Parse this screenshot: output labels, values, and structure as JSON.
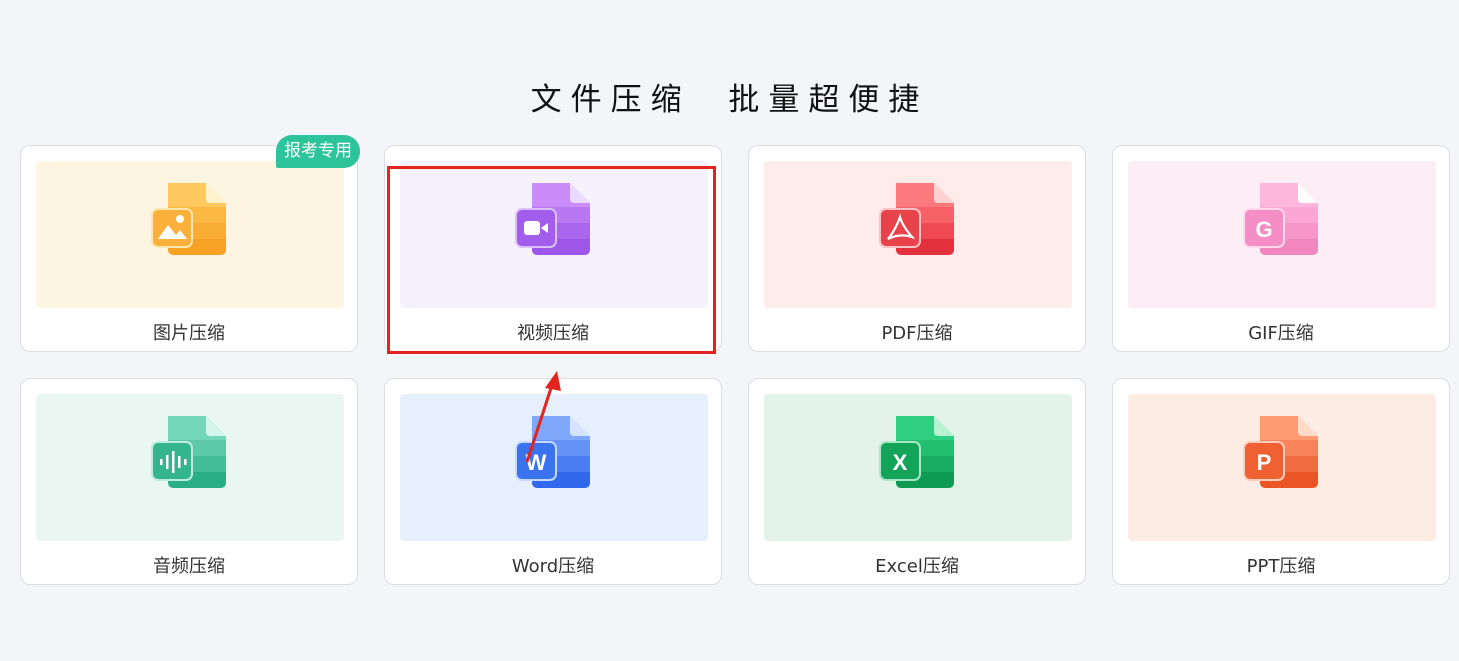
{
  "headline": "文件压缩  批量超便捷",
  "badge": "报考专用",
  "cards": [
    {
      "label": "图片压缩",
      "icon": "image-file-icon",
      "panel_color": "#fdf5e2",
      "icon_colors": [
        "#ffd57e",
        "#f8a524"
      ]
    },
    {
      "label": "视频压缩",
      "icon": "video-file-icon",
      "panel_color": "#f5f2fd",
      "icon_colors": [
        "#cf9bfb",
        "#9a52e8"
      ]
    },
    {
      "label": "PDF压缩",
      "icon": "pdf-file-icon",
      "panel_color": "#feeceb",
      "icon_colors": [
        "#ff8a8a",
        "#e2303d"
      ]
    },
    {
      "label": "GIF压缩",
      "icon": "gif-file-icon",
      "panel_color": "#fdeef6",
      "icon_colors": [
        "#fdb9df",
        "#f27fbd"
      ]
    },
    {
      "label": "音频压缩",
      "icon": "audio-file-icon",
      "panel_color": "#eaf6f1",
      "icon_colors": [
        "#7ed8bd",
        "#23aa83"
      ]
    },
    {
      "label": "Word压缩",
      "icon": "word-file-icon",
      "panel_color": "#e6f0fd",
      "icon_colors": [
        "#8eb3ff",
        "#2f68ea"
      ]
    },
    {
      "label": "Excel压缩",
      "icon": "excel-file-icon",
      "panel_color": "#e4f3ea",
      "icon_colors": [
        "#2fd180",
        "#0f9a52"
      ]
    },
    {
      "label": "PPT压缩",
      "icon": "ppt-file-icon",
      "panel_color": "#fdece3",
      "icon_colors": [
        "#ffa07a",
        "#ea5525"
      ]
    }
  ],
  "highlight_color": "#e3231c"
}
